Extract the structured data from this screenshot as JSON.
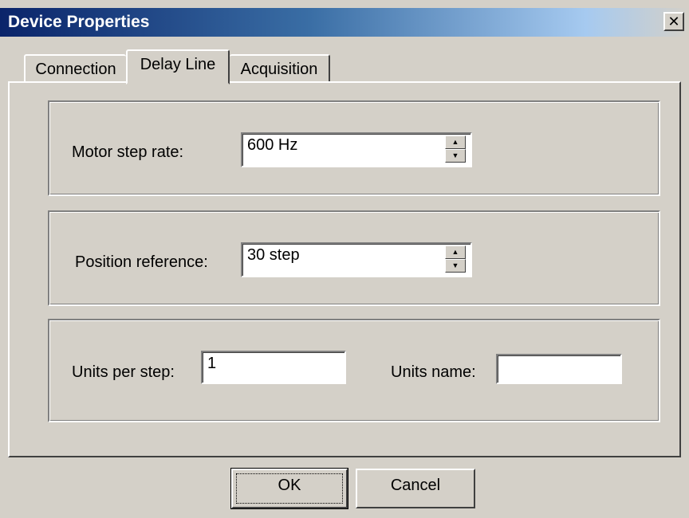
{
  "window": {
    "title": "Device Properties",
    "close_glyph": "✕"
  },
  "tabs": [
    {
      "label": "Connection",
      "selected": false
    },
    {
      "label": "Delay Line",
      "selected": true
    },
    {
      "label": "Acquisition",
      "selected": false
    }
  ],
  "delay_line": {
    "motor_step_rate": {
      "label": "Motor step rate:",
      "value": "600 Hz"
    },
    "position_reference": {
      "label": "Position reference:",
      "value": "30 step"
    },
    "units_per_step": {
      "label": "Units per step:",
      "value": "1"
    },
    "units_name": {
      "label": "Units name:",
      "value": ""
    }
  },
  "buttons": {
    "ok": "OK",
    "cancel": "Cancel"
  },
  "icons": {
    "spin_up": "arrow-up-icon",
    "spin_down": "arrow-down-icon",
    "close": "close-icon"
  },
  "colors": {
    "title_active": "#0a246a",
    "face": "#d4d0c8"
  }
}
